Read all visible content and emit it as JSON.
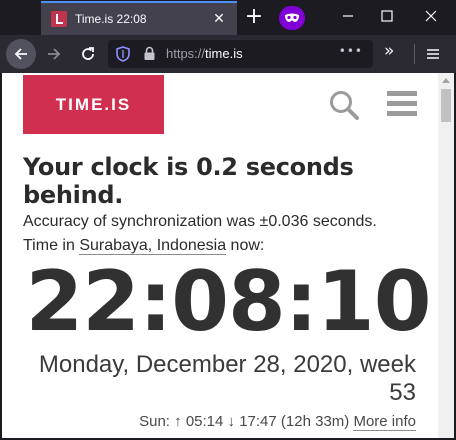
{
  "tab": {
    "title": "Time.is 22:08"
  },
  "urlbar": {
    "scheme": "https://",
    "host": "time.is",
    "more": "•••"
  },
  "site": {
    "logo": "TIME.IS",
    "headline": "Your clock is 0.2 seconds behind.",
    "accuracy": "Accuracy of synchronization was ±0.036 seconds.",
    "location_prefix": "Time in ",
    "location_place": "Surabaya, Indonesia",
    "location_suffix": " now:",
    "clock": "22:08:10",
    "date": "Monday, December 28, 2020, week 53",
    "sun_prefix": "Sun: ",
    "sunrise": "05:14",
    "sunset": "17:47",
    "daylength": "(12h 33m)",
    "more_info": "More info"
  },
  "colors": {
    "brand": "#d12f4f",
    "private": "#8000d7",
    "tab_accent": "#4e8ef7"
  },
  "icons": [
    "search-icon",
    "hamburger-menu-icon",
    "lock-icon",
    "shield-icon",
    "reload-icon",
    "back-arrow-icon",
    "forward-arrow-icon",
    "private-mask-icon"
  ]
}
